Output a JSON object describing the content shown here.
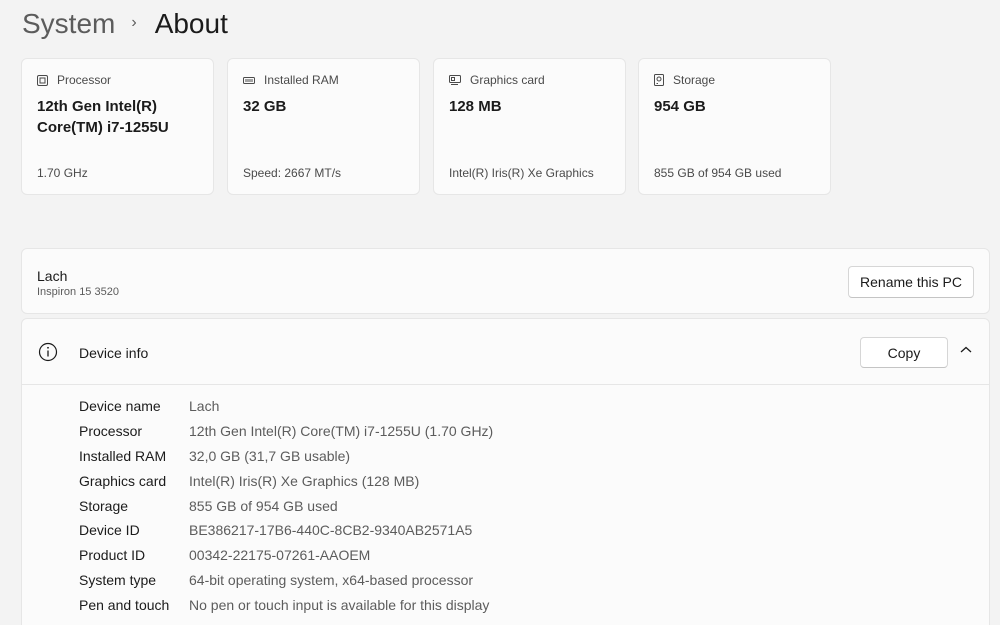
{
  "breadcrumb": {
    "parent": "System",
    "separator": "›",
    "current": "About"
  },
  "cards": [
    {
      "icon": "processor-icon",
      "label": "Processor",
      "value": "12th Gen Intel(R) Core(TM) i7-1255U",
      "sub": "1.70 GHz"
    },
    {
      "icon": "ram-icon",
      "label": "Installed RAM",
      "value": "32 GB",
      "sub": "Speed: 2667 MT/s"
    },
    {
      "icon": "graphics-card-icon",
      "label": "Graphics card",
      "value": "128 MB",
      "sub": "Intel(R) Iris(R) Xe Graphics"
    },
    {
      "icon": "storage-icon",
      "label": "Storage",
      "value": "954 GB",
      "sub": "855 GB of 954 GB used"
    }
  ],
  "rename": {
    "pc_name": "Lach",
    "model": "Inspiron 15 3520",
    "button": "Rename this PC"
  },
  "device_info": {
    "title": "Device info",
    "copy_button": "Copy",
    "rows": [
      {
        "label": "Device name",
        "value": "Lach"
      },
      {
        "label": "Processor",
        "value": "12th Gen Intel(R) Core(TM) i7-1255U (1.70 GHz)"
      },
      {
        "label": "Installed RAM",
        "value": "32,0 GB (31,7 GB usable)"
      },
      {
        "label": "Graphics card",
        "value": "Intel(R) Iris(R) Xe Graphics (128 MB)"
      },
      {
        "label": "Storage",
        "value": "855 GB of 954 GB used"
      },
      {
        "label": "Device ID",
        "value": "BE386217-17B6-440C-8CB2-9340AB2571A5"
      },
      {
        "label": "Product ID",
        "value": "00342-22175-07261-AAOEM"
      },
      {
        "label": "System type",
        "value": "64-bit operating system, x64-based processor"
      },
      {
        "label": "Pen and touch",
        "value": "No pen or touch input is available for this display"
      }
    ]
  }
}
